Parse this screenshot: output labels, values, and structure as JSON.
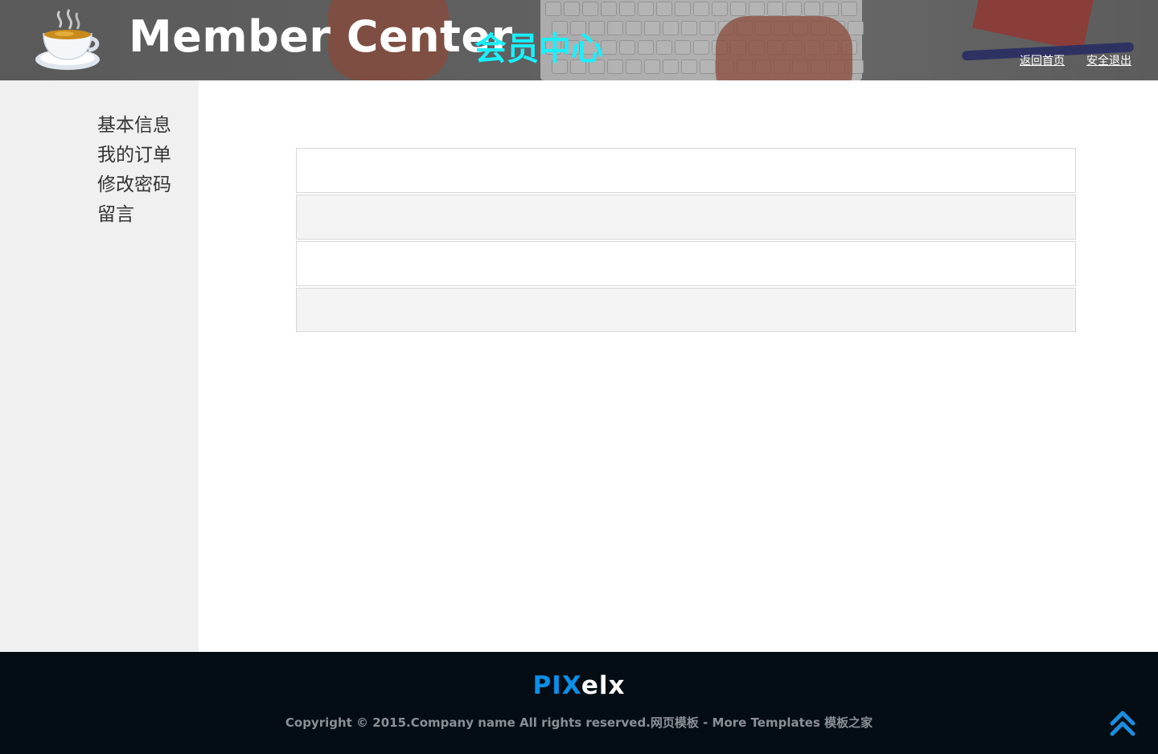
{
  "header": {
    "title_en": "Member Center",
    "title_cn": "会员中心",
    "title_cn_color": "#19f0ff",
    "links": {
      "home": "返回首页",
      "logout": "安全退出"
    }
  },
  "sidebar": {
    "items": [
      {
        "label": "基本信息"
      },
      {
        "label": "我的订单"
      },
      {
        "label": "修改密码"
      },
      {
        "label": "留言"
      }
    ]
  },
  "main": {
    "rows": [
      "",
      "",
      "",
      ""
    ]
  },
  "footer": {
    "logo_part1": "PIX",
    "logo_part2": "elx",
    "logo_accent": "#0b8fe8",
    "copyright": "Copyright © 2015.Company name All rights reserved.网页模板 - More Templates 模板之家",
    "to_top_icon": "double-chevron-up-icon"
  }
}
